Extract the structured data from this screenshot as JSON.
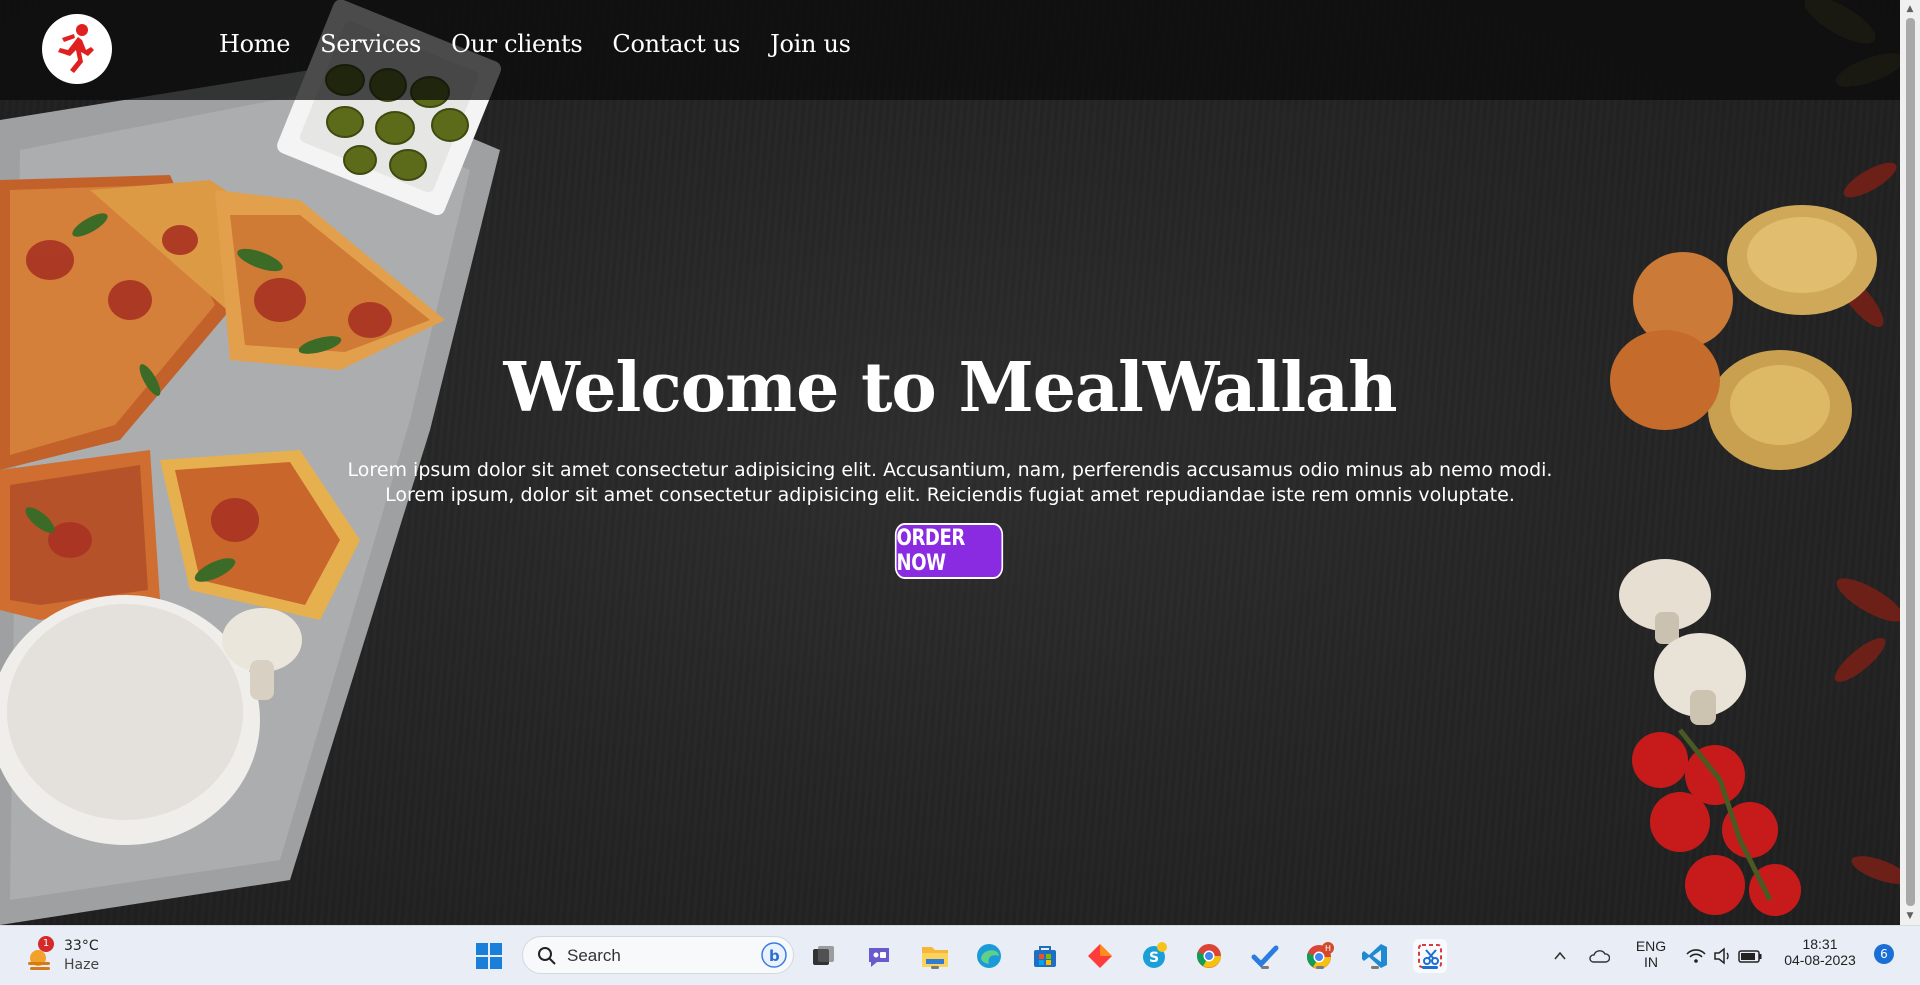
{
  "nav": {
    "logo_alt": "MealWallah logo",
    "links": [
      "Home",
      "Services",
      "Our clients",
      "Contact us",
      "Join us"
    ]
  },
  "hero": {
    "title": "Welcome to MealWallah",
    "line1": "Lorem ipsum dolor sit amet consectetur adipisicing elit. Accusantium, nam, perferendis accusamus odio minus ab nemo modi.",
    "line2": "Lorem ipsum, dolor sit amet consectetur adipisicing elit. Reiciendis fugiat amet repudiandae iste rem omnis voluptate.",
    "cta": "ORDER NOW"
  },
  "colors": {
    "cta_background": "#8a2be2",
    "logo_red": "#e02020",
    "nav_background": "rgba(10,10,10,0.72)"
  },
  "taskbar": {
    "weather": {
      "badge": "1",
      "temp": "33°C",
      "condition": "Haze"
    },
    "search_placeholder": "Search",
    "apps": [
      "start-icon",
      "search-icon",
      "task-view-icon",
      "chat-icon",
      "file-explorer-icon",
      "edge-icon",
      "store-icon",
      "office-icon",
      "skype-icon",
      "chrome-icon",
      "todo-icon",
      "chrome-profile-icon",
      "vscode-icon",
      "snipping-tool-icon"
    ],
    "tray": {
      "language_top": "ENG",
      "language_bottom": "IN",
      "time": "18:31",
      "date": "04-08-2023",
      "notifications": "6"
    }
  }
}
